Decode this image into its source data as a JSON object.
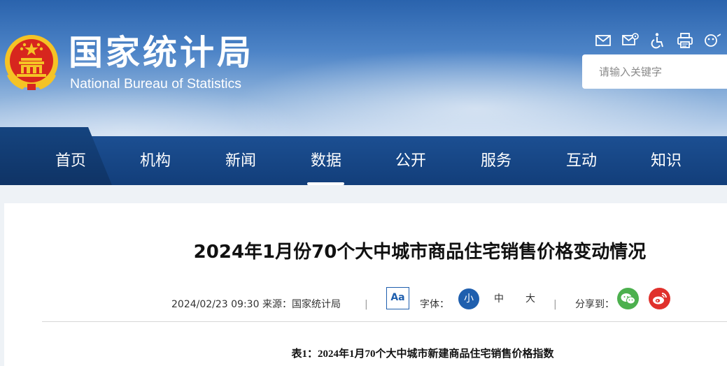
{
  "site": {
    "name_cn": "国家统计局",
    "name_en": "National Bureau of Statistics"
  },
  "toolbar": {
    "icons": [
      "mail-icon",
      "mail-settings-icon",
      "accessibility-icon",
      "print-icon",
      "elder-mode-icon"
    ]
  },
  "search": {
    "placeholder": "请输入关键字"
  },
  "nav": {
    "items": [
      {
        "label": "首页"
      },
      {
        "label": "机构"
      },
      {
        "label": "新闻"
      },
      {
        "label": "数据",
        "active": true
      },
      {
        "label": "公开"
      },
      {
        "label": "服务"
      },
      {
        "label": "互动"
      },
      {
        "label": "知识"
      }
    ]
  },
  "article": {
    "title": "2024年1月份70个大中城市商品住宅销售价格变动情况",
    "date": "2024/02/23 09:30",
    "source": "来源：国家统计局",
    "separator": "|",
    "font_toggle_label": "Aa",
    "font_label": "字体：",
    "font_sizes": [
      "小",
      "中",
      "大"
    ],
    "share_label": "分享到：",
    "table_caption": "表1：2024年1月70个大中城市新建商品住宅销售价格指数"
  },
  "colors": {
    "nav_bg": "#1c4f92",
    "accent": "#1f5fae",
    "wechat": "#4cb04e",
    "weibo": "#e0312c",
    "emblem_red": "#d7261e",
    "emblem_gold": "#f5c325"
  }
}
